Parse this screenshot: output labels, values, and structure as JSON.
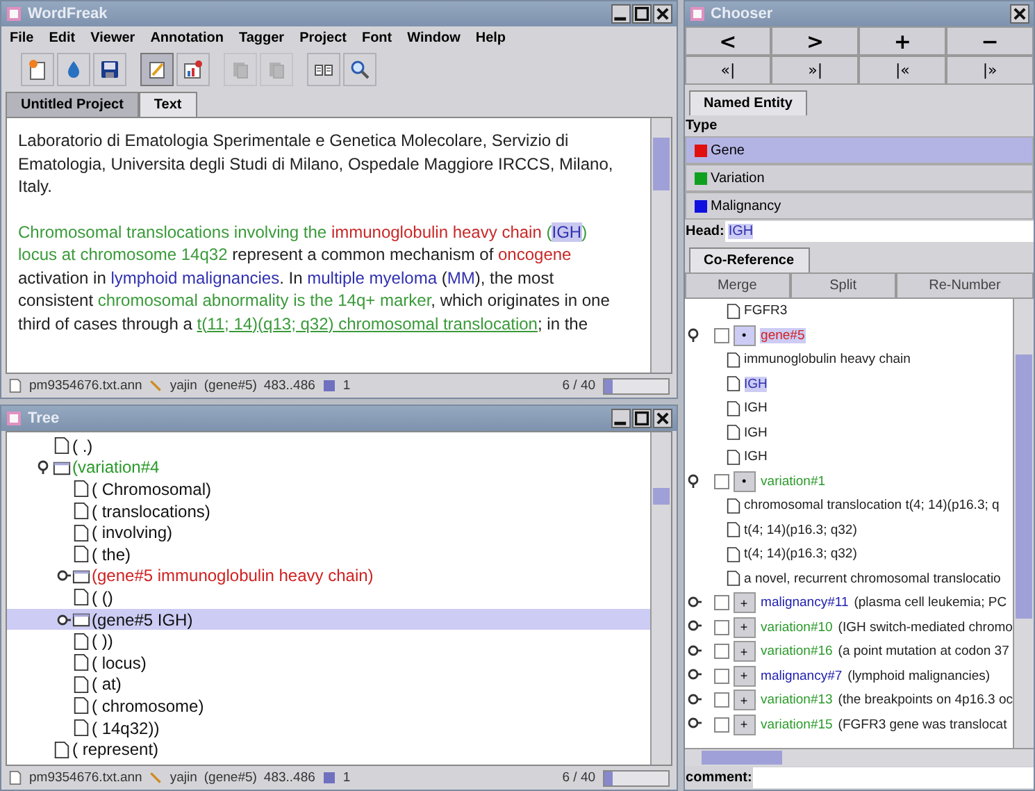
{
  "main_window": {
    "title": "WordFreak",
    "menu": [
      "File",
      "Edit",
      "Viewer",
      "Annotation",
      "Tagger",
      "Project",
      "Font",
      "Window",
      "Help"
    ],
    "toolbar": [
      {
        "kind": "new",
        "disabled": false,
        "pressed": false
      },
      {
        "kind": "open",
        "disabled": false,
        "pressed": false
      },
      {
        "kind": "save",
        "disabled": false,
        "pressed": false
      },
      {
        "kind": "edit",
        "disabled": false,
        "pressed": true
      },
      {
        "kind": "chart",
        "disabled": false,
        "pressed": false
      },
      {
        "kind": "copy",
        "disabled": true,
        "pressed": false
      },
      {
        "kind": "paste",
        "disabled": true,
        "pressed": false
      },
      {
        "kind": "book",
        "disabled": false,
        "pressed": false
      },
      {
        "kind": "search",
        "disabled": false,
        "pressed": false
      }
    ],
    "tabs": [
      {
        "label": "Untitled Project",
        "selected": false
      },
      {
        "label": "Text",
        "selected": true
      }
    ],
    "paragraphs": [
      [
        {
          "text": "Laboratorio di Ematologia Sperimentale e Genetica Molecolare, Servizio di Ematologia, Universita degli Studi di Milano, Ospedale Maggiore IRCCS, Milano, Italy.",
          "kind": "plain"
        }
      ],
      [
        {
          "text": "Chromosomal translocations involving the ",
          "kind": "variation"
        },
        {
          "text": "immunoglobulin heavy chain",
          "kind": "gene"
        },
        {
          "text": " (",
          "kind": "variation"
        },
        {
          "text": "IGH",
          "kind": "head"
        },
        {
          "text": ") locus at chromosome 14q32",
          "kind": "variation"
        },
        {
          "text": " represent a common mechanism of ",
          "kind": "plain"
        },
        {
          "text": "oncogene",
          "kind": "gene"
        },
        {
          "text": " activation in ",
          "kind": "plain"
        },
        {
          "text": "lymphoid malignancies",
          "kind": "malignancy"
        },
        {
          "text": ". In ",
          "kind": "plain"
        },
        {
          "text": "multiple myeloma",
          "kind": "malignancy"
        },
        {
          "text": " (",
          "kind": "plain"
        },
        {
          "text": "MM",
          "kind": "malignancy"
        },
        {
          "text": "), the most consistent ",
          "kind": "plain"
        },
        {
          "text": "chromosomal abnormality is the 14q+ marker",
          "kind": "variation"
        },
        {
          "text": ", which originates in one third of cases through a ",
          "kind": "plain"
        },
        {
          "text": "t(11; 14)(q13; q32) chromosomal translocation",
          "kind": "underlined"
        },
        {
          "text": "; in the",
          "kind": "plain"
        }
      ]
    ],
    "status": {
      "file": "pm9354676.txt.ann",
      "user": "yajin",
      "entity": "(gene#5)",
      "span": "483..486",
      "count": "1",
      "page": "6 / 40",
      "level": 0.15
    }
  },
  "tree_window": {
    "title": "Tree",
    "nodes": [
      {
        "label": "( .)",
        "kind": "leaf",
        "selected": false
      },
      {
        "label": "(variation#4",
        "kind": "variation",
        "expanded": true,
        "selected": false,
        "children": [
          {
            "label": "( Chromosomal)",
            "kind": "leaf",
            "selected": false
          },
          {
            "label": "( translocations)",
            "kind": "leaf",
            "selected": false
          },
          {
            "label": "( involving)",
            "kind": "leaf",
            "selected": false
          },
          {
            "label": "( the)",
            "kind": "leaf",
            "selected": false
          },
          {
            "label": "(gene#5  immunoglobulin heavy chain)",
            "kind": "gene",
            "expanded": false,
            "selected": false
          },
          {
            "label": "( ()",
            "kind": "leaf",
            "selected": false
          },
          {
            "label": "(gene#5  IGH)",
            "kind": "gene",
            "expanded": false,
            "selected": true
          },
          {
            "label": "( ))",
            "kind": "leaf",
            "selected": false
          },
          {
            "label": "( locus)",
            "kind": "leaf",
            "selected": false
          },
          {
            "label": "( at)",
            "kind": "leaf",
            "selected": false
          },
          {
            "label": "( chromosome)",
            "kind": "leaf",
            "selected": false
          },
          {
            "label": "( 14q32))",
            "kind": "leaf",
            "selected": false
          }
        ]
      },
      {
        "label": "( represent)",
        "kind": "leaf",
        "selected": false
      }
    ],
    "status": {
      "file": "pm9354676.txt.ann",
      "user": "yajin",
      "entity": "(gene#5)",
      "span": "483..486",
      "count": "1",
      "page": "6 / 40",
      "level": 0.15
    }
  },
  "chooser": {
    "title": "Chooser",
    "nav_buttons": [
      "<",
      ">",
      "+",
      "−",
      "«|",
      "»|",
      "|«",
      "|»"
    ],
    "tab": "Named Entity",
    "type_label": "Type",
    "types": [
      {
        "label": "Gene",
        "color": "#e01010",
        "selected": true
      },
      {
        "label": "Variation",
        "color": "#10a020",
        "selected": false
      },
      {
        "label": "Malignancy",
        "color": "#1010e0",
        "selected": false
      }
    ],
    "head_label": "Head:",
    "head_value": "IGH",
    "coref_tab": "Co-Reference",
    "coref_buttons": [
      "Merge",
      "Split",
      "Re-Number"
    ],
    "items": [
      {
        "kind": "mention",
        "text": "FGFR3",
        "selected": false
      },
      {
        "kind": "gene",
        "name": "gene#5",
        "mark": "•",
        "checked": false,
        "expanded": true,
        "selected": true,
        "children": [
          {
            "text": "immunoglobulin heavy chain",
            "selected": false
          },
          {
            "text": "IGH",
            "selected": true
          },
          {
            "text": "IGH",
            "selected": false
          },
          {
            "text": "IGH",
            "selected": false
          },
          {
            "text": "IGH",
            "selected": false
          }
        ]
      },
      {
        "kind": "variation",
        "name": "variation#1",
        "mark": "•",
        "checked": false,
        "expanded": true,
        "selected": false,
        "children": [
          {
            "text": "chromosomal translocation t(4; 14)(p16.3; q",
            "selected": false
          },
          {
            "text": "t(4; 14)(p16.3; q32)",
            "selected": false
          },
          {
            "text": "t(4; 14)(p16.3; q32)",
            "selected": false
          },
          {
            "text": "a novel, recurrent chromosomal translocatio",
            "selected": false
          }
        ]
      },
      {
        "kind": "malignancy",
        "name": "malignancy#11",
        "detail": "(plasma cell leukemia; PC",
        "mark": "+",
        "checked": false,
        "expanded": false,
        "selected": false
      },
      {
        "kind": "variation",
        "name": "variation#10",
        "detail": "(IGH switch-mediated chromo",
        "mark": "+",
        "checked": false,
        "expanded": false,
        "selected": false
      },
      {
        "kind": "variation",
        "name": "variation#16",
        "detail": "(a point mutation at codon 37",
        "mark": "+",
        "checked": false,
        "expanded": false,
        "selected": false
      },
      {
        "kind": "malignancy",
        "name": "malignancy#7",
        "detail": "(lymphoid malignancies)",
        "mark": "+",
        "checked": false,
        "expanded": false,
        "selected": false
      },
      {
        "kind": "variation",
        "name": "variation#13",
        "detail": "(the breakpoints on 4p16.3 oc",
        "mark": "+",
        "checked": false,
        "expanded": false,
        "selected": false
      },
      {
        "kind": "variation",
        "name": "variation#15",
        "detail": "(FGFR3 gene was translocat",
        "mark": "+",
        "checked": false,
        "expanded": false,
        "selected": false
      }
    ],
    "comment_label": "comment:"
  }
}
